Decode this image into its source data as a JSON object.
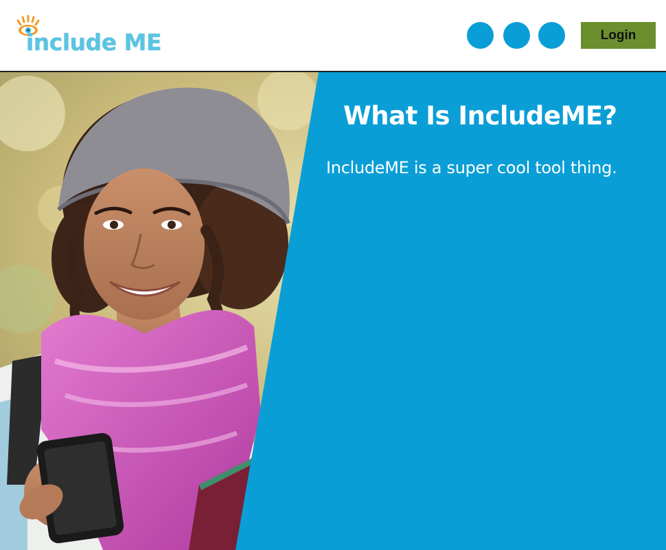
{
  "header": {
    "logo_text": "include ME",
    "nav_circles": [
      "",
      "",
      ""
    ],
    "login_label": "Login"
  },
  "hero": {
    "title": "What Is IncludeME?",
    "description": "IncludeME is a super cool tool thing."
  },
  "colors": {
    "brand_blue": "#0a9ed6",
    "logo_blue": "#5bc4e3",
    "logo_orange": "#f39a2a",
    "login_green": "#6b8e2f"
  }
}
